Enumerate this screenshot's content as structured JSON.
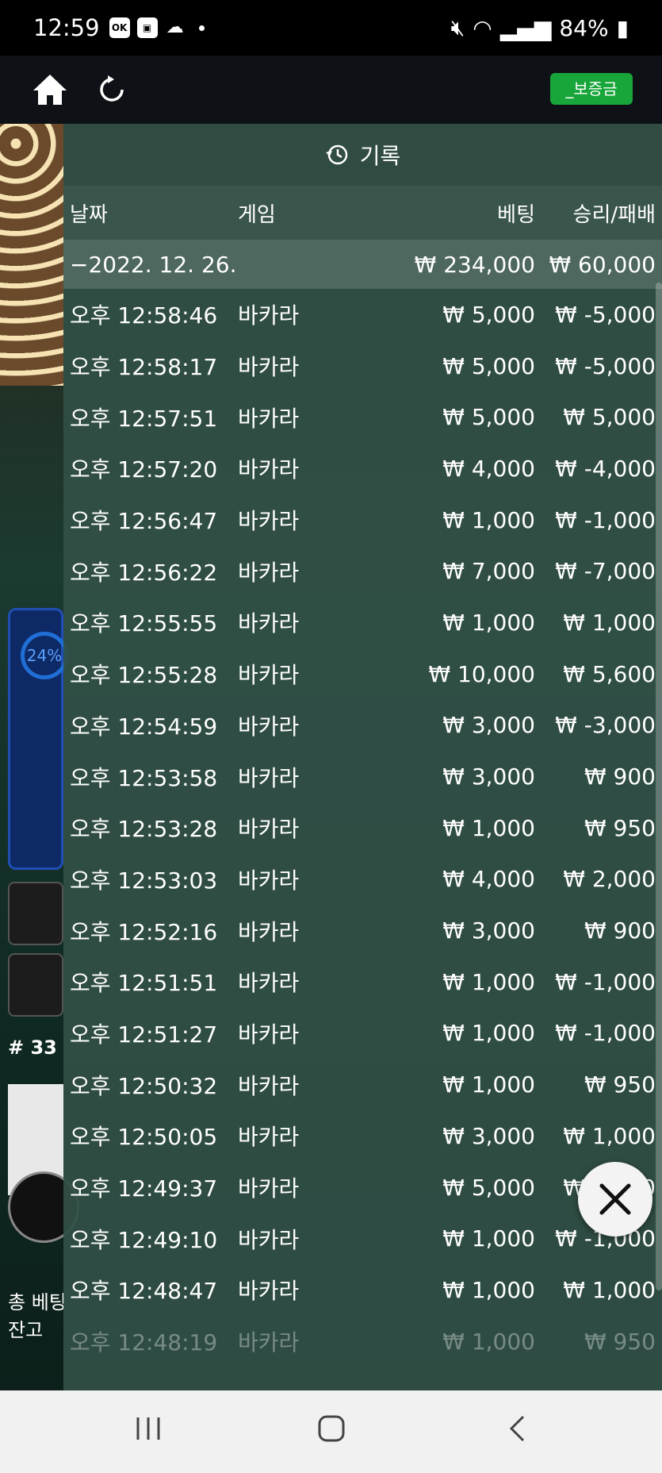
{
  "status_bar": {
    "time": "12:59",
    "icons": [
      "ok-icon",
      "gallery-icon",
      "cloud-icon"
    ],
    "battery": "84%"
  },
  "top_bar": {
    "deposit_label": "_보증금"
  },
  "background": {
    "percent": "24%",
    "round_number": "# 33",
    "label_total_bet": "총 베팅",
    "label_balance": "잔고"
  },
  "history": {
    "title": "기록",
    "columns": {
      "date": "날짜",
      "game": "게임",
      "bet": "베팅",
      "win_loss": "승리/패배"
    },
    "date_group": {
      "label": "−2022. 12. 26.",
      "bet_total": "₩ 234,000",
      "win_total": "₩ 60,000"
    },
    "rows": [
      {
        "time": "오후 12:58:46",
        "game": "바카라",
        "bet": "₩ 5,000",
        "result": "₩ -5,000"
      },
      {
        "time": "오후 12:58:17",
        "game": "바카라",
        "bet": "₩ 5,000",
        "result": "₩ -5,000"
      },
      {
        "time": "오후 12:57:51",
        "game": "바카라",
        "bet": "₩ 5,000",
        "result": "₩ 5,000"
      },
      {
        "time": "오후 12:57:20",
        "game": "바카라",
        "bet": "₩ 4,000",
        "result": "₩ -4,000"
      },
      {
        "time": "오후 12:56:47",
        "game": "바카라",
        "bet": "₩ 1,000",
        "result": "₩ -1,000"
      },
      {
        "time": "오후 12:56:22",
        "game": "바카라",
        "bet": "₩ 7,000",
        "result": "₩ -7,000"
      },
      {
        "time": "오후 12:55:55",
        "game": "바카라",
        "bet": "₩ 1,000",
        "result": "₩ 1,000"
      },
      {
        "time": "오후 12:55:28",
        "game": "바카라",
        "bet": "₩ 10,000",
        "result": "₩ 5,600"
      },
      {
        "time": "오후 12:54:59",
        "game": "바카라",
        "bet": "₩ 3,000",
        "result": "₩ -3,000"
      },
      {
        "time": "오후 12:53:58",
        "game": "바카라",
        "bet": "₩ 3,000",
        "result": "₩ 900"
      },
      {
        "time": "오후 12:53:28",
        "game": "바카라",
        "bet": "₩ 1,000",
        "result": "₩ 950"
      },
      {
        "time": "오후 12:53:03",
        "game": "바카라",
        "bet": "₩ 4,000",
        "result": "₩ 2,000"
      },
      {
        "time": "오후 12:52:16",
        "game": "바카라",
        "bet": "₩ 3,000",
        "result": "₩ 900"
      },
      {
        "time": "오후 12:51:51",
        "game": "바카라",
        "bet": "₩ 1,000",
        "result": "₩ -1,000"
      },
      {
        "time": "오후 12:51:27",
        "game": "바카라",
        "bet": "₩ 1,000",
        "result": "₩ -1,000"
      },
      {
        "time": "오후 12:50:32",
        "game": "바카라",
        "bet": "₩ 1,000",
        "result": "₩ 950"
      },
      {
        "time": "오후 12:50:05",
        "game": "바카라",
        "bet": "₩ 3,000",
        "result": "₩ 1,000"
      },
      {
        "time": "오후 12:49:37",
        "game": "바카라",
        "bet": "₩ 5,000",
        "result": "₩ 2,000"
      },
      {
        "time": "오후 12:49:10",
        "game": "바카라",
        "bet": "₩ 1,000",
        "result": "₩ -1,000"
      },
      {
        "time": "오후 12:48:47",
        "game": "바카라",
        "bet": "₩ 1,000",
        "result": "₩ 1,000"
      },
      {
        "time": "오후 12:48:19",
        "game": "바카라",
        "bet": "₩ 1,000",
        "result": "₩ 950"
      }
    ]
  }
}
